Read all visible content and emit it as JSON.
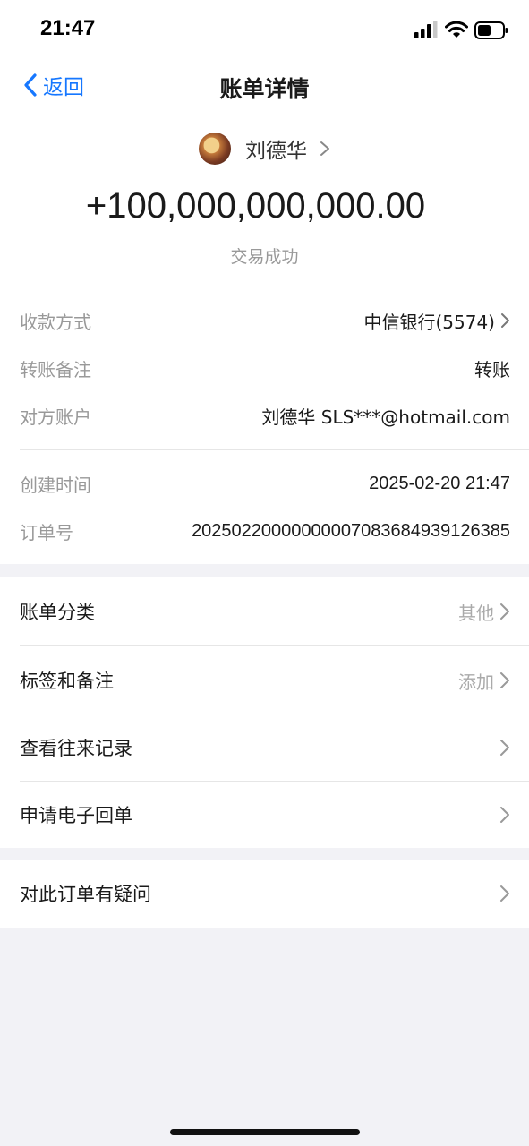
{
  "status_bar": {
    "time": "21:47"
  },
  "nav": {
    "back_label": "返回",
    "title": "账单详情"
  },
  "header": {
    "payee_name": "刘德华",
    "amount": "+100,000,000,000.00",
    "status": "交易成功"
  },
  "details": {
    "rows": [
      {
        "label": "收款方式",
        "value": "中信银行(5574)"
      },
      {
        "label": "转账备注",
        "value": "转账"
      },
      {
        "label": "对方账户",
        "value": "刘德华 SLS***@hotmail.com"
      },
      {
        "label": "创建时间",
        "value": "2025-02-20 21:47"
      },
      {
        "label": "订单号",
        "value": "20250220000000007083684939126385"
      }
    ]
  },
  "list": {
    "items": [
      {
        "label": "账单分类",
        "right": "其他"
      },
      {
        "label": "标签和备注",
        "right": "添加"
      },
      {
        "label": "查看往来记录",
        "right": ""
      },
      {
        "label": "申请电子回单",
        "right": ""
      }
    ],
    "question": {
      "label": "对此订单有疑问"
    }
  }
}
